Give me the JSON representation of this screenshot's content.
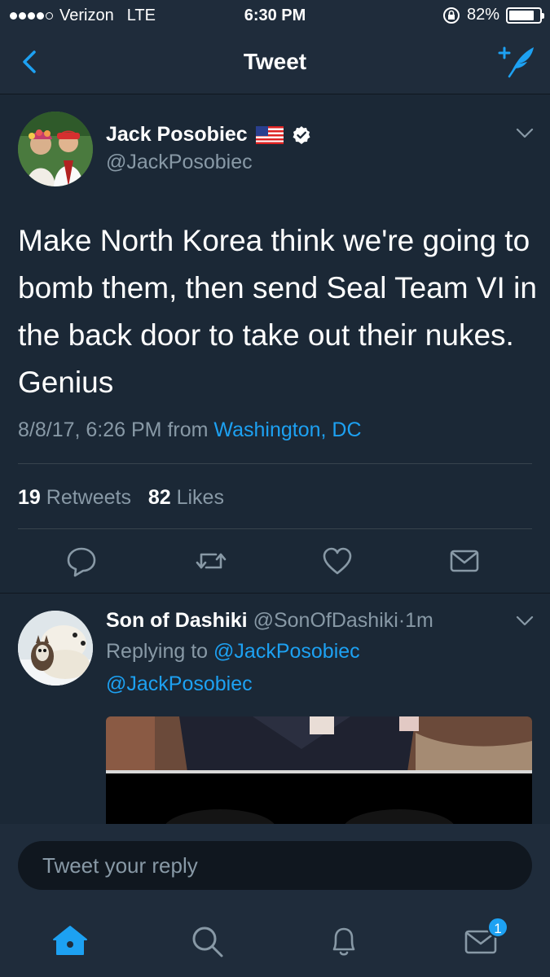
{
  "status_bar": {
    "carrier": "Verizon",
    "network": "LTE",
    "time": "6:30 PM",
    "battery": "82%",
    "battery_level": 0.82,
    "signal_bars": 4
  },
  "nav": {
    "title": "Tweet",
    "back_icon": "chevron-left-icon",
    "compose_icon": "compose-tweet-icon"
  },
  "tweet": {
    "author_name": "Jack Posobiec",
    "author_handle": "@JackPosobiec",
    "text": "Make North Korea think we're going to bomb them, then send Seal Team VI in the back door to take out their nukes. Genius",
    "date": "8/8/17, 6:26 PM",
    "from_label": "from",
    "location": "Washington, DC",
    "retweets_count": "19",
    "retweets_label": "Retweets",
    "likes_count": "82",
    "likes_label": "Likes"
  },
  "reply": {
    "author_name": "Son of Dashiki",
    "author_handle": "@SonOfDashiki",
    "separator": "·",
    "time_ago": "1m",
    "replying_label": "Replying to",
    "replying_to": "@JackPosobiec",
    "mention": "@JackPosobiec"
  },
  "reply_bar": {
    "placeholder": "Tweet your reply"
  },
  "tabs": {
    "messages_badge": "1"
  },
  "colors": {
    "background": "#1b2836",
    "bar": "#1f2c3b",
    "accent": "#1da1f2",
    "secondary_text": "#8899a6"
  }
}
